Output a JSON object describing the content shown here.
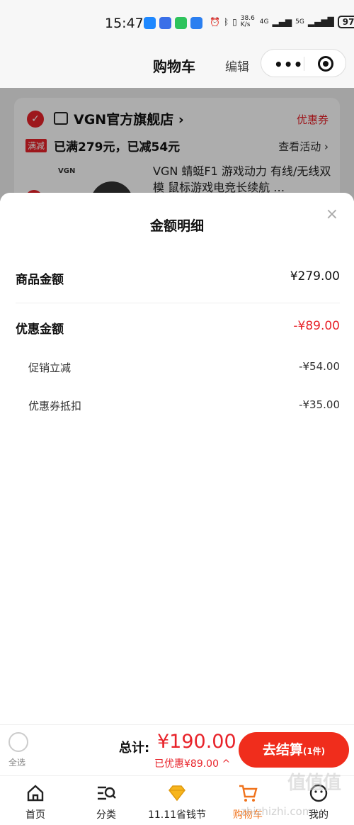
{
  "status_bar": {
    "time": "15:47",
    "net_speed": "38.6 K/s",
    "signal_a": "4G",
    "signal_b": "5G",
    "battery": "97"
  },
  "nav": {
    "title": "购物车",
    "edit": "编辑"
  },
  "store": {
    "name": "VGN官方旗舰店",
    "coupon": "优惠券",
    "promo_tag": "满减",
    "promo_text": "已满279元，已减54元",
    "activity_link": "查看活动",
    "product_logo": "VGN",
    "product_title": "VGN 蜻蜓F1 游戏动力 有线/无线双模 鼠标游戏电竞长续航 …"
  },
  "sheet": {
    "title": "金额明细",
    "close": "×",
    "goods_label": "商品金额",
    "goods_value": "¥279.00",
    "discount_label": "优惠金额",
    "discount_value": "-¥89.00",
    "sub_items": [
      {
        "label": "促销立减",
        "value": "-¥54.00"
      },
      {
        "label": "优惠券抵扣",
        "value": "-¥35.00"
      }
    ]
  },
  "checkout": {
    "select_all": "全选",
    "total_label": "总计:",
    "total_amount": "¥190.00",
    "discount_line": "已优惠¥89.00",
    "button_label": "去结算",
    "button_count": "(1件)"
  },
  "tabs": [
    {
      "label": "首页",
      "icon": "home-icon"
    },
    {
      "label": "分类",
      "icon": "category-search-icon"
    },
    {
      "label": "11.11省钱节",
      "icon": "diamond-icon"
    },
    {
      "label": "购物车",
      "icon": "cart-icon"
    },
    {
      "label": "我的",
      "icon": "profile-icon"
    }
  ],
  "watermark": {
    "mark": "值值值",
    "url": "zhizhizhi.com"
  },
  "colors": {
    "accent": "#e8232a",
    "checkout": "#f02d1c",
    "active_tab": "#f0731c"
  }
}
